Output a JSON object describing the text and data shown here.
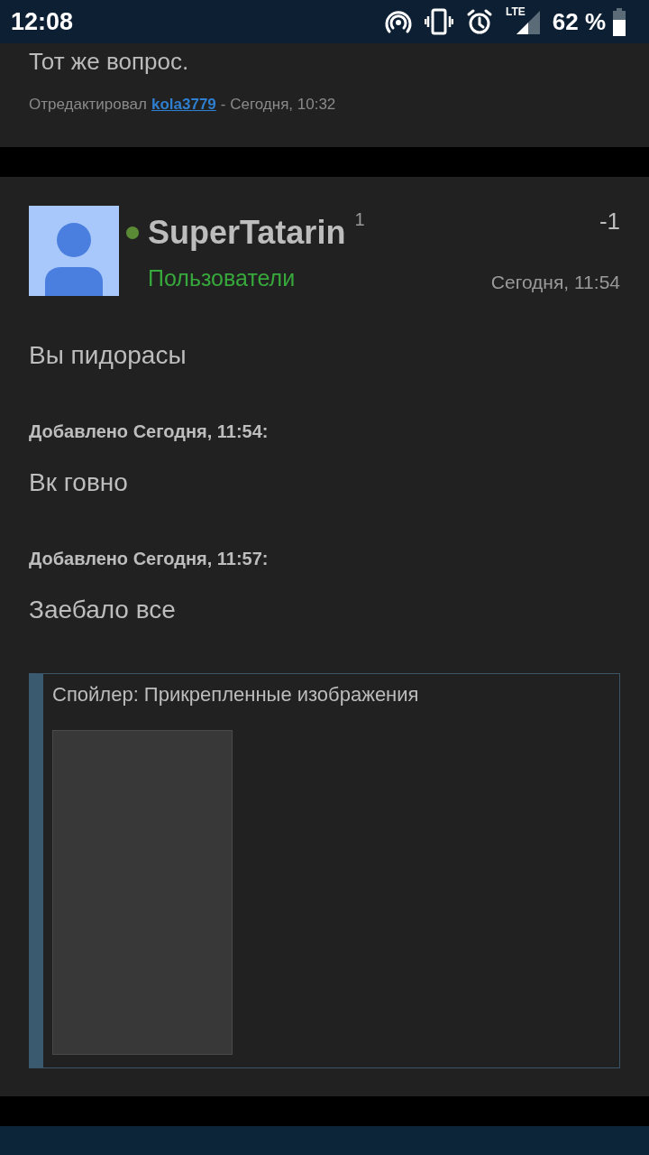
{
  "status_bar": {
    "time": "12:08",
    "network": "LTE",
    "battery": "62 %"
  },
  "previous_post": {
    "text": "Тот же вопрос.",
    "edited_prefix": "Отредактировал",
    "edited_by": "kola3779",
    "edited_suffix": "- Сегодня, 10:32"
  },
  "post": {
    "author": "SuperTatarin",
    "online": true,
    "reputation": "1",
    "group": "Пользователи",
    "rating": "-1",
    "date": "Сегодня, 11:54",
    "body": [
      {
        "kind": "text",
        "text": "Вы пидорасы"
      },
      {
        "kind": "added",
        "text": "Добавлено Сегодня, 11:54:"
      },
      {
        "kind": "text",
        "text": "Вк говно"
      },
      {
        "kind": "added",
        "text": "Добавлено Сегодня, 11:57:"
      },
      {
        "kind": "text",
        "text": "Заебало все"
      }
    ],
    "spoiler": {
      "title": "Спойлер: Прикрепленные изображения",
      "expanded": true,
      "attachments": [
        {
          "kind": "thumbnail"
        }
      ]
    }
  }
}
